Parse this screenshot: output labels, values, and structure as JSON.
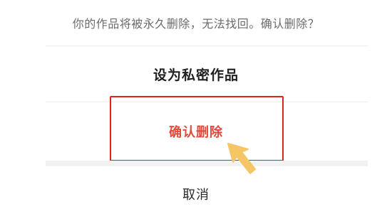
{
  "dialog": {
    "warning_text": "你的作品将被永久删除，无法找回。确认删除？",
    "options": {
      "set_private": "设为私密作品",
      "confirm_delete": "确认删除",
      "cancel": "取消"
    }
  },
  "colors": {
    "delete_text": "#e04a3a",
    "highlight_border": "#e02121",
    "pointer_arrow": "#f5c566"
  },
  "icons": {
    "pointer": "arrow-pointer-icon"
  }
}
